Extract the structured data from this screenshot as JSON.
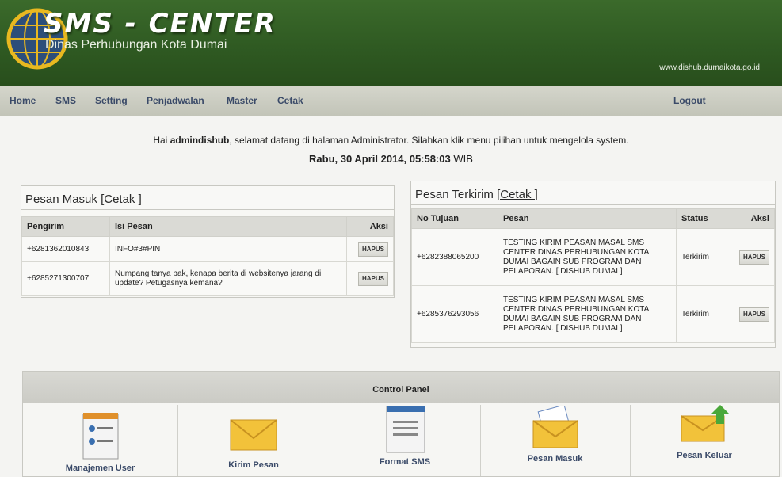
{
  "header": {
    "title": "SMS - CENTER",
    "subtitle": "Dinas Perhubungan Kota Dumai",
    "site_url": "www.dishub.dumaikota.go.id"
  },
  "nav": {
    "items": [
      "Home",
      "SMS",
      "Setting",
      "Penjadwalan",
      "Master",
      "Cetak"
    ],
    "logout": "Logout"
  },
  "greeting": {
    "prefix": "Hai ",
    "username": "admindishub",
    "suffix": ", selamat datang di halaman Administrator. Silahkan klik menu pilihan untuk mengelola system.",
    "date_bold": "Rabu, 30 April 2014, 05:58:03",
    "timezone": " WIB"
  },
  "inbox": {
    "title": "Pesan Masuk",
    "print_link": "[Cetak ]",
    "columns": [
      "Pengirim",
      "Isi Pesan",
      "Aksi"
    ],
    "rows": [
      {
        "sender": "+6281362010843",
        "message": "INFO#3#PIN",
        "action": "HAPUS"
      },
      {
        "sender": "+6285271300707",
        "message": "Numpang tanya pak, kenapa berita di websitenya jarang di update? Petugasnya kemana?",
        "action": "HAPUS"
      }
    ]
  },
  "outbox": {
    "title": "Pesan Terkirim",
    "print_link": "[Cetak ]",
    "columns": [
      "No Tujuan",
      "Pesan",
      "Status",
      "Aksi"
    ],
    "rows": [
      {
        "recipient": "+6282388065200",
        "message": "TESTING KIRIM PEASAN MASAL SMS CENTER DINAS PERHUBUNGAN KOTA DUMAI BAGAIN SUB PROGRAM DAN PELAPORAN. [ DISHUB DUMAI ]",
        "status": "Terkirim",
        "action": "HAPUS"
      },
      {
        "recipient": "+6285376293056",
        "message": "TESTING KIRIM PEASAN MASAL SMS CENTER DINAS PERHUBUNGAN KOTA DUMAI BAGAIN SUB PROGRAM DAN PELAPORAN. [ DISHUB DUMAI ]",
        "status": "Terkirim",
        "action": "HAPUS"
      }
    ]
  },
  "control_panel": {
    "title": "Control Panel",
    "items": [
      {
        "label": "Manajemen User",
        "icon": "user-list-icon"
      },
      {
        "label": "Kirim Pesan",
        "icon": "envelope-icon"
      },
      {
        "label": "Format SMS",
        "icon": "document-icon"
      },
      {
        "label": "Pesan Masuk",
        "icon": "open-envelope-icon"
      },
      {
        "label": "Pesan Keluar",
        "icon": "outgoing-envelope-icon"
      }
    ]
  },
  "colors": {
    "header_green": "#2f5a22",
    "nav_text": "#3a4a68",
    "envelope_yellow": "#f2c23a"
  }
}
